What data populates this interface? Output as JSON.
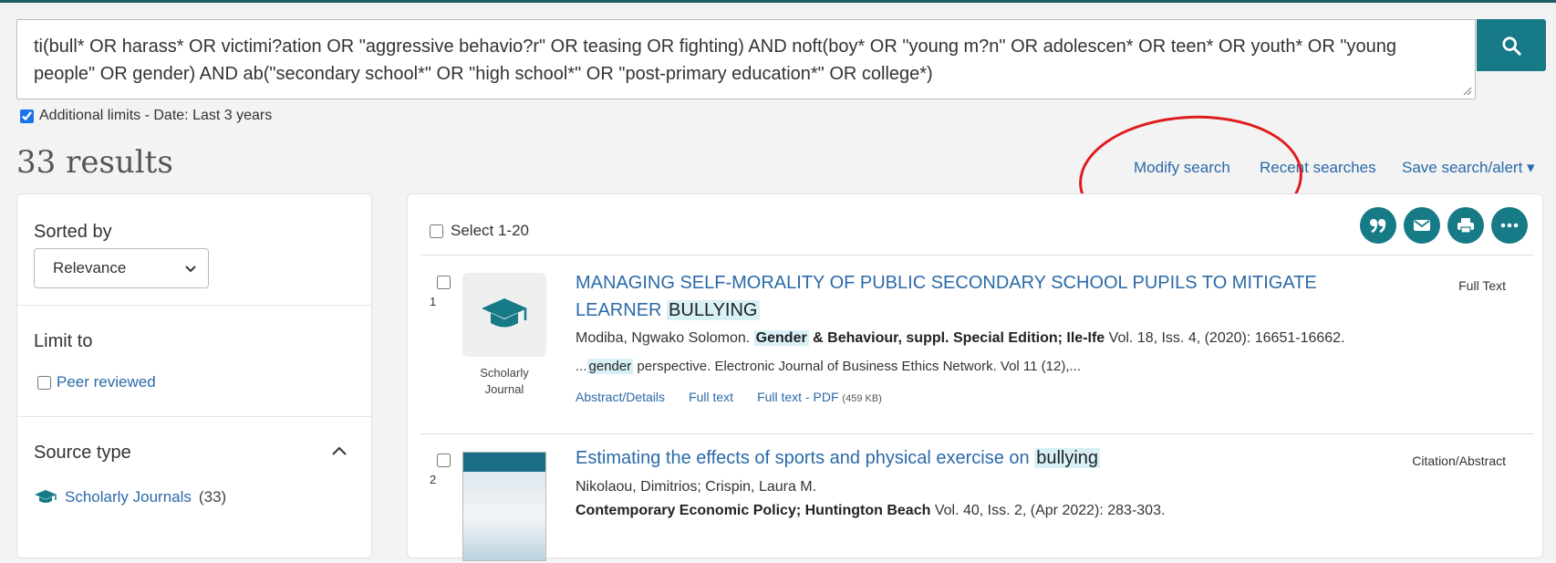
{
  "search": {
    "query": "ti(bull* OR harass* OR victimi?ation OR \"aggressive behavio?r\" OR teasing OR fighting) AND noft(boy* OR \"young m?n\" OR adolescen* OR teen* OR youth* OR \"young people\" OR gender) AND ab(\"secondary school*\" OR \"high school*\" OR \"post-primary education*\" OR college*)"
  },
  "limits": {
    "label": "Additional limits - Date: Last 3 years",
    "checked": true
  },
  "results_count": "33 results",
  "top_links": {
    "modify": "Modify search",
    "recent": "Recent searches",
    "save": "Save search/alert ▾"
  },
  "sidebar": {
    "sorted_by": "Sorted by",
    "sort_value": "Relevance",
    "limit_to": "Limit to",
    "peer_reviewed": "Peer reviewed",
    "source_type": "Source type",
    "source_item": "Scholarly Journals",
    "source_count": "(33)"
  },
  "main": {
    "select_all": "Select 1-20",
    "results": [
      {
        "num": "1",
        "thumb_label_1": "Scholarly",
        "thumb_label_2": "Journal",
        "title_a": "MANAGING SELF-MORALITY OF PUBLIC SECONDARY SCHOOL PUPILS TO MITIGATE LEARNER",
        "title_hl": "BULLYING",
        "type": "Full Text",
        "author": "Modiba, Ngwako Solomon.",
        "pub_hl": "Gender",
        "pub_rest": "& Behaviour, suppl. Special Edition; Ile-Ife",
        "pub_details": "Vol. 18, Iss. 4,  (2020): 16651-16662.",
        "snip_pre": "...",
        "snip_hl": "gender",
        "snip_rest": "perspective. Electronic Journal of Business Ethics Network. Vol 11 (12),...",
        "link_abstract": "Abstract/Details",
        "link_fulltext": "Full text",
        "link_pdf": "Full text - PDF",
        "pdf_size": "(459 KB)"
      },
      {
        "num": "2",
        "title_a": "Estimating the effects of sports and physical exercise on",
        "title_hl": "bullying",
        "type": "Citation/Abstract",
        "author": "Nikolaou, Dimitrios; Crispin, Laura M.",
        "pub": "Contemporary Economic Policy; Huntington Beach",
        "pub_details": "Vol. 40, Iss. 2,  (Apr 2022): 283-303."
      }
    ]
  },
  "colors": {
    "teal": "#167a87",
    "link": "#2b6aa8",
    "highlight": "#d8f1f7",
    "annotation": "#e01b1b"
  }
}
